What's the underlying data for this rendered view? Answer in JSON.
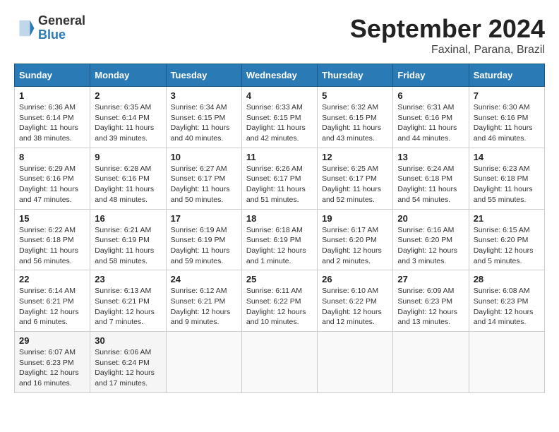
{
  "header": {
    "logo_line1": "General",
    "logo_line2": "Blue",
    "month": "September 2024",
    "location": "Faxinal, Parana, Brazil"
  },
  "days_of_week": [
    "Sunday",
    "Monday",
    "Tuesday",
    "Wednesday",
    "Thursday",
    "Friday",
    "Saturday"
  ],
  "weeks": [
    [
      {
        "num": "1",
        "info": "Sunrise: 6:36 AM\nSunset: 6:14 PM\nDaylight: 11 hours\nand 38 minutes."
      },
      {
        "num": "2",
        "info": "Sunrise: 6:35 AM\nSunset: 6:14 PM\nDaylight: 11 hours\nand 39 minutes."
      },
      {
        "num": "3",
        "info": "Sunrise: 6:34 AM\nSunset: 6:15 PM\nDaylight: 11 hours\nand 40 minutes."
      },
      {
        "num": "4",
        "info": "Sunrise: 6:33 AM\nSunset: 6:15 PM\nDaylight: 11 hours\nand 42 minutes."
      },
      {
        "num": "5",
        "info": "Sunrise: 6:32 AM\nSunset: 6:15 PM\nDaylight: 11 hours\nand 43 minutes."
      },
      {
        "num": "6",
        "info": "Sunrise: 6:31 AM\nSunset: 6:16 PM\nDaylight: 11 hours\nand 44 minutes."
      },
      {
        "num": "7",
        "info": "Sunrise: 6:30 AM\nSunset: 6:16 PM\nDaylight: 11 hours\nand 46 minutes."
      }
    ],
    [
      {
        "num": "8",
        "info": "Sunrise: 6:29 AM\nSunset: 6:16 PM\nDaylight: 11 hours\nand 47 minutes."
      },
      {
        "num": "9",
        "info": "Sunrise: 6:28 AM\nSunset: 6:16 PM\nDaylight: 11 hours\nand 48 minutes."
      },
      {
        "num": "10",
        "info": "Sunrise: 6:27 AM\nSunset: 6:17 PM\nDaylight: 11 hours\nand 50 minutes."
      },
      {
        "num": "11",
        "info": "Sunrise: 6:26 AM\nSunset: 6:17 PM\nDaylight: 11 hours\nand 51 minutes."
      },
      {
        "num": "12",
        "info": "Sunrise: 6:25 AM\nSunset: 6:17 PM\nDaylight: 11 hours\nand 52 minutes."
      },
      {
        "num": "13",
        "info": "Sunrise: 6:24 AM\nSunset: 6:18 PM\nDaylight: 11 hours\nand 54 minutes."
      },
      {
        "num": "14",
        "info": "Sunrise: 6:23 AM\nSunset: 6:18 PM\nDaylight: 11 hours\nand 55 minutes."
      }
    ],
    [
      {
        "num": "15",
        "info": "Sunrise: 6:22 AM\nSunset: 6:18 PM\nDaylight: 11 hours\nand 56 minutes."
      },
      {
        "num": "16",
        "info": "Sunrise: 6:21 AM\nSunset: 6:19 PM\nDaylight: 11 hours\nand 58 minutes."
      },
      {
        "num": "17",
        "info": "Sunrise: 6:19 AM\nSunset: 6:19 PM\nDaylight: 11 hours\nand 59 minutes."
      },
      {
        "num": "18",
        "info": "Sunrise: 6:18 AM\nSunset: 6:19 PM\nDaylight: 12 hours\nand 1 minute."
      },
      {
        "num": "19",
        "info": "Sunrise: 6:17 AM\nSunset: 6:20 PM\nDaylight: 12 hours\nand 2 minutes."
      },
      {
        "num": "20",
        "info": "Sunrise: 6:16 AM\nSunset: 6:20 PM\nDaylight: 12 hours\nand 3 minutes."
      },
      {
        "num": "21",
        "info": "Sunrise: 6:15 AM\nSunset: 6:20 PM\nDaylight: 12 hours\nand 5 minutes."
      }
    ],
    [
      {
        "num": "22",
        "info": "Sunrise: 6:14 AM\nSunset: 6:21 PM\nDaylight: 12 hours\nand 6 minutes."
      },
      {
        "num": "23",
        "info": "Sunrise: 6:13 AM\nSunset: 6:21 PM\nDaylight: 12 hours\nand 7 minutes."
      },
      {
        "num": "24",
        "info": "Sunrise: 6:12 AM\nSunset: 6:21 PM\nDaylight: 12 hours\nand 9 minutes."
      },
      {
        "num": "25",
        "info": "Sunrise: 6:11 AM\nSunset: 6:22 PM\nDaylight: 12 hours\nand 10 minutes."
      },
      {
        "num": "26",
        "info": "Sunrise: 6:10 AM\nSunset: 6:22 PM\nDaylight: 12 hours\nand 12 minutes."
      },
      {
        "num": "27",
        "info": "Sunrise: 6:09 AM\nSunset: 6:23 PM\nDaylight: 12 hours\nand 13 minutes."
      },
      {
        "num": "28",
        "info": "Sunrise: 6:08 AM\nSunset: 6:23 PM\nDaylight: 12 hours\nand 14 minutes."
      }
    ],
    [
      {
        "num": "29",
        "info": "Sunrise: 6:07 AM\nSunset: 6:23 PM\nDaylight: 12 hours\nand 16 minutes."
      },
      {
        "num": "30",
        "info": "Sunrise: 6:06 AM\nSunset: 6:24 PM\nDaylight: 12 hours\nand 17 minutes."
      },
      {
        "num": "",
        "info": ""
      },
      {
        "num": "",
        "info": ""
      },
      {
        "num": "",
        "info": ""
      },
      {
        "num": "",
        "info": ""
      },
      {
        "num": "",
        "info": ""
      }
    ]
  ]
}
